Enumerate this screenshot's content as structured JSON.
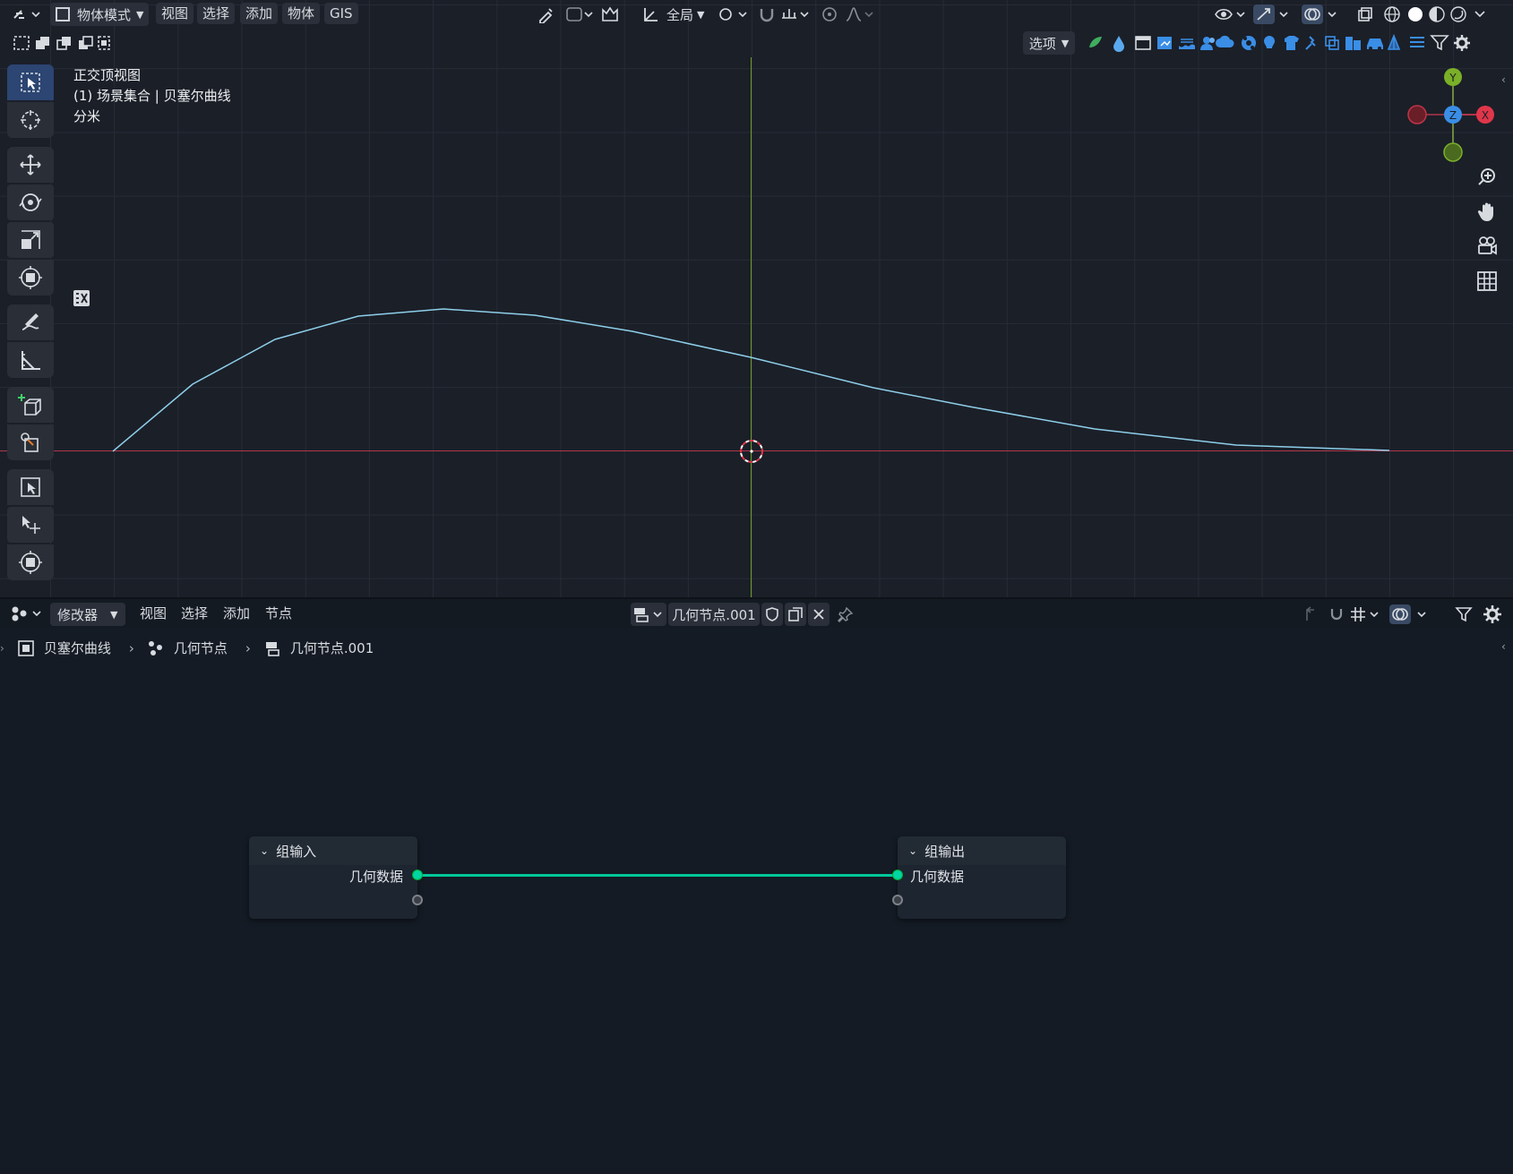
{
  "viewport": {
    "header": {
      "mode_label": "物体模式",
      "menus": [
        "视图",
        "选择",
        "添加",
        "物体",
        "GIS"
      ],
      "transform_orientation": "全局",
      "options_label": "选项"
    },
    "overlay_text": {
      "view_name": "正交顶视图",
      "collection_line": "(1) 场景集合 | 贝塞尔曲线",
      "units": "分米"
    },
    "gizmo": {
      "y": "Y",
      "z": "Z",
      "x": "X"
    },
    "toolbar_icons": [
      "select-box-icon",
      "cursor-icon",
      "move-icon",
      "rotate-icon",
      "scale-icon",
      "transform-icon",
      "annotate-icon",
      "measure-icon",
      "add-cube-icon",
      "extrude-icon",
      "select-box2-icon",
      "move-point-icon",
      "transform2-icon"
    ],
    "colors": {
      "curve": "#8ecfea",
      "x_axis": "#a03040",
      "y_axis": "#6a9a2a",
      "active_tool": "#2c4572"
    }
  },
  "node_editor": {
    "header": {
      "editor_type_label": "修改器",
      "menus": [
        "视图",
        "选择",
        "添加",
        "节点"
      ],
      "node_tree_name": "几何节点.001"
    },
    "breadcrumb": [
      "贝塞尔曲线",
      "几何节点",
      "几何节点.001"
    ],
    "nodes": {
      "group_input": {
        "title": "组输入",
        "socket_label": "几何数据"
      },
      "group_output": {
        "title": "组输出",
        "socket_label": "几何数据"
      }
    },
    "colors": {
      "geometry_socket": "#00d6a3",
      "link": "#00c89a"
    }
  }
}
